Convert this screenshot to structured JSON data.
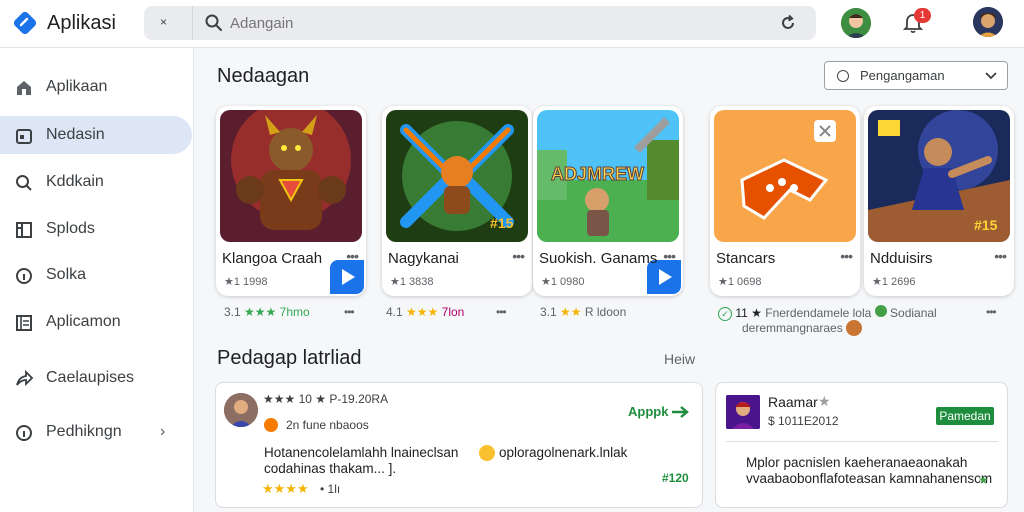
{
  "header": {
    "app_title": "Aplikasi",
    "search_close": "×",
    "search_placeholder": "Adangain",
    "notification_count": "1"
  },
  "sidebar": {
    "items": [
      {
        "label": "Aplikaan",
        "icon": "home-icon"
      },
      {
        "label": "Nedasin",
        "icon": "folder-icon"
      },
      {
        "label": "Kddkain",
        "icon": "search-icon"
      },
      {
        "label": "Splods",
        "icon": "grid-icon"
      },
      {
        "label": "Solka",
        "icon": "info-icon"
      },
      {
        "label": "Aplicamon",
        "icon": "list-icon"
      },
      {
        "label": "Caelaupises",
        "icon": "share-icon"
      },
      {
        "label": "Pedhikngn",
        "icon": "info-icon"
      }
    ],
    "expand_chevron": "›"
  },
  "main": {
    "section_title": "Nedaagan",
    "filter_label": "Pengangaman",
    "cards": [
      {
        "title": "Klangoa Craah",
        "meta": "★1 1998",
        "thumb": "monster-game-art"
      },
      {
        "title": "Nagykanai",
        "meta": "★1 3838",
        "thumb": "fighter-game-art"
      },
      {
        "title": "Suokish. Ganams",
        "meta": "★1 0980",
        "thumb": "adventure-game-art"
      },
      {
        "title": "Stancars",
        "meta": "★1 0698",
        "thumb": "controller-app-art"
      },
      {
        "title": "Ndduisirs",
        "meta": "★1 2696",
        "thumb": "hero-game-art"
      }
    ],
    "card_more": "•••",
    "row2": [
      {
        "prefix": "3.1",
        "stars": "★★★",
        "text": "7hmo",
        "more": "•••"
      },
      {
        "prefix": "4.1",
        "stars": "★★★",
        "text": "7lon",
        "more": "•••"
      },
      {
        "prefix": "3.1",
        "stars": "★★",
        "text": "R ldoon",
        "more": ""
      }
    ],
    "row2_extra": {
      "rating": "11 ★",
      "text_line1": "Fnerdendamele lola",
      "text_line2": "deremmangnaraes",
      "badge_text": "Sodianal",
      "more": "•••"
    },
    "section2_title": "Pedagap latrliad",
    "section2_link": "Heiw"
  },
  "reviews": [
    {
      "rating_line": "★★★ 10 ★ P-19.20RA",
      "sub_line": "2n fune nbaoos",
      "body_line1": "Hotanencolelamlahh lnaineclsan",
      "body_line1b": "oploragolnenark.lnlak",
      "body_line2": "codahinas thakam... ].",
      "footer_stars": "★★★★",
      "footer_text": "• 1lı",
      "apply": "Apppk",
      "price": "#120"
    },
    {
      "name": "Raamar",
      "sub_line": "$ 1011E2012",
      "promo": "Pamedan",
      "body_line1": "Mplor pacnislen kaeheranaeaonakah",
      "body_line2": "vvaabaobonflafoteasan kamnahanenscm"
    }
  ],
  "colors": {
    "accent": "#1a73e8",
    "active_nav": "#dce6f5",
    "green": "#1e8e3e",
    "star": "#f4b400"
  }
}
